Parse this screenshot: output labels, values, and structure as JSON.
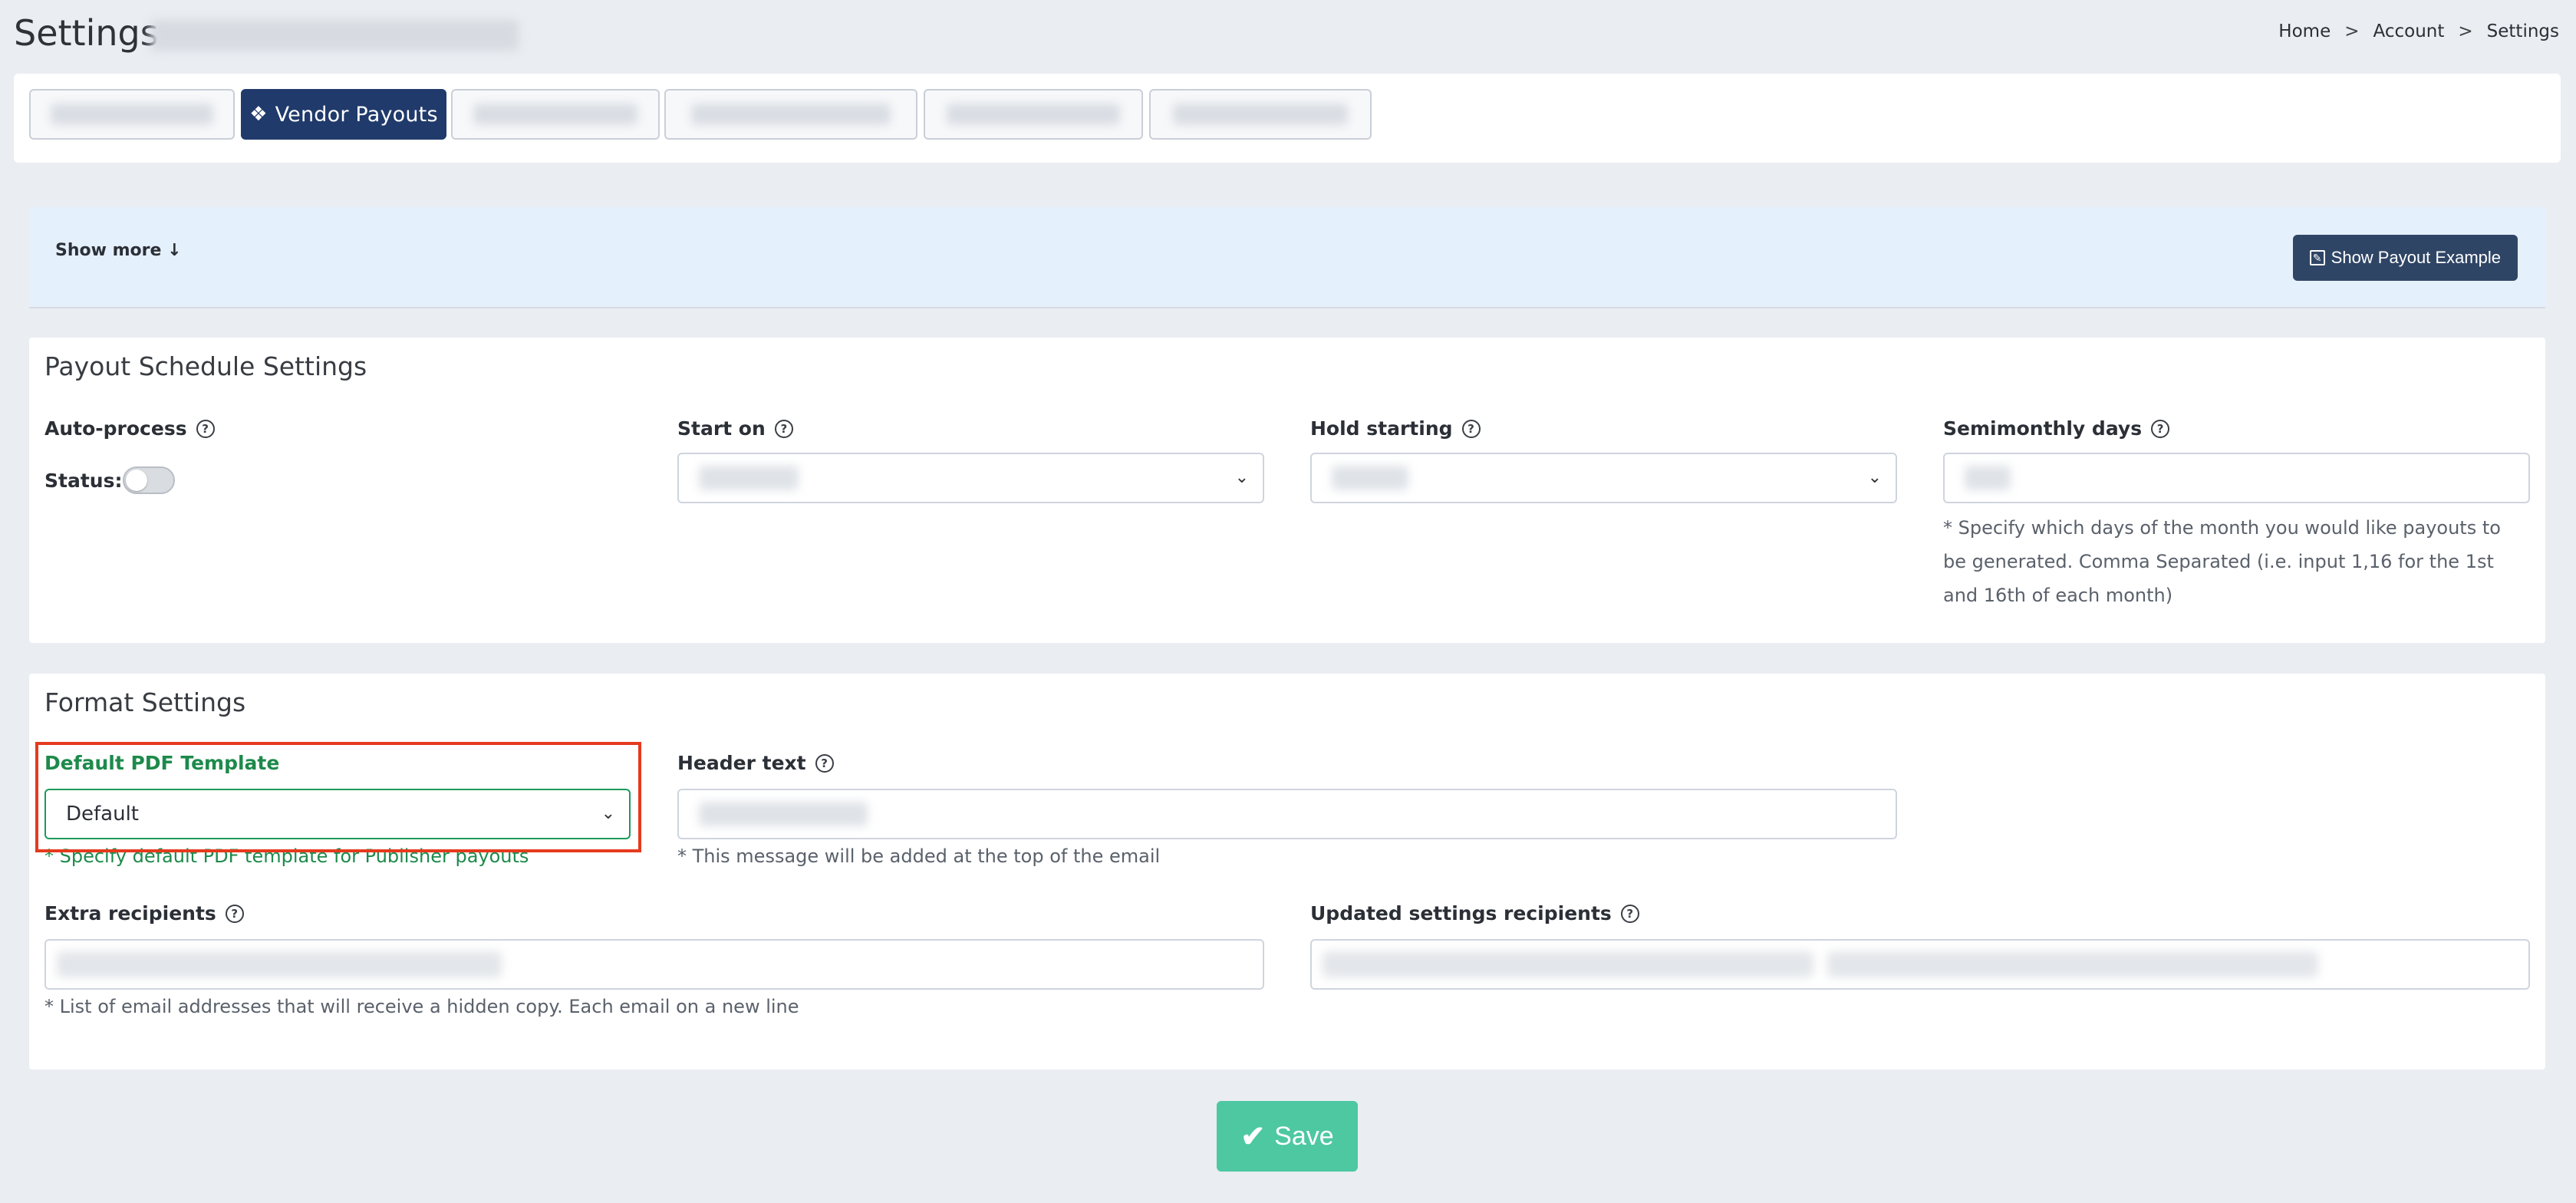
{
  "header": {
    "title": "Settings",
    "breadcrumb": [
      "Home",
      "Account",
      "Settings"
    ],
    "breadcrumb_sep": ">"
  },
  "tabs": [
    {
      "label": "",
      "active": false
    },
    {
      "label": "Vendor Payouts",
      "active": true,
      "icon": "cubes-icon"
    },
    {
      "label": "",
      "active": false
    },
    {
      "label": "",
      "active": false
    },
    {
      "label": "",
      "active": false
    },
    {
      "label": "",
      "active": false
    }
  ],
  "info": {
    "show_more": "Show more ↓",
    "payout_example": "Show Payout Example"
  },
  "schedule": {
    "title": "Payout Schedule Settings",
    "auto_process": "Auto-process",
    "status_label": "Status:",
    "status_on": false,
    "start_on_label": "Start on",
    "hold_starting_label": "Hold starting",
    "semimonthly_label": "Semimonthly days",
    "semimonthly_hint": "* Specify which days of the month you would like payouts to be generated. Comma Separated (i.e. input 1,16 for the 1st and 16th of each month)"
  },
  "format": {
    "title": "Format Settings",
    "pdf_template_label": "Default PDF Template",
    "pdf_template_value": "Default",
    "pdf_template_hint": "* Specify default PDF template for Publisher payouts",
    "header_text_label": "Header text",
    "header_text_hint": "* This message will be added at the top of the email",
    "extra_recipients_label": "Extra recipients",
    "extra_recipients_hint": "* List of email addresses that will receive a hidden copy. Each email on a new line",
    "updated_recipients_label": "Updated settings recipients"
  },
  "save": {
    "label": "Save"
  },
  "colors": {
    "primary": "#203a6b",
    "success": "#4dc8a1",
    "green_text": "#1d8a4b",
    "highlight": "#e53a1e"
  }
}
